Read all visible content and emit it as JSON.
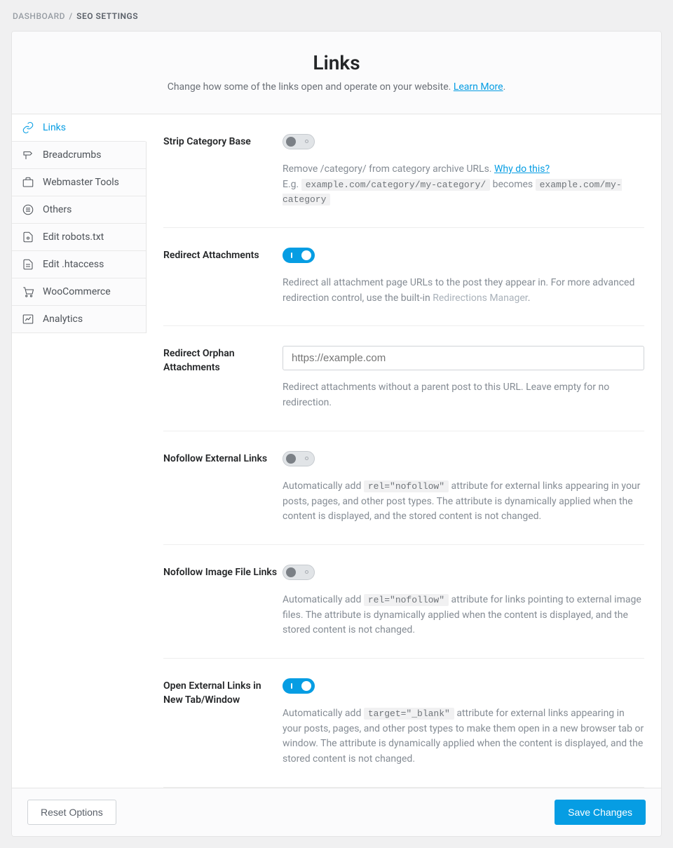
{
  "breadcrumb": {
    "parent": "Dashboard",
    "separator": "/",
    "current": "SEO Settings"
  },
  "header": {
    "title": "Links",
    "subtitle_pre": "Change how some of the links open and operate on your website. ",
    "learn_more": "Learn More",
    "subtitle_post": "."
  },
  "sidebar": {
    "items": [
      {
        "label": "Links"
      },
      {
        "label": "Breadcrumbs"
      },
      {
        "label": "Webmaster Tools"
      },
      {
        "label": "Others"
      },
      {
        "label": "Edit robots.txt"
      },
      {
        "label": "Edit .htaccess"
      },
      {
        "label": "WooCommerce"
      },
      {
        "label": "Analytics"
      }
    ]
  },
  "settings": {
    "strip_category": {
      "label": "Strip Category Base",
      "desc_pre": "Remove /category/ from category archive URLs. ",
      "why_link": "Why do this?",
      "line2_pre": "E.g. ",
      "code1": "example.com/category/my-category/",
      "middle": " becomes ",
      "code2": "example.com/my-category"
    },
    "redirect_attachments": {
      "label": "Redirect Attachments",
      "desc_pre": "Redirect all attachment page URLs to the post they appear in. For more advanced redirection control, use the built-in ",
      "link": "Redirections Manager",
      "desc_post": "."
    },
    "redirect_orphan": {
      "label": "Redirect Orphan Attachments",
      "placeholder": "https://example.com",
      "desc": "Redirect attachments without a parent post to this URL. Leave empty for no redirection."
    },
    "nofollow_external": {
      "label": "Nofollow External Links",
      "desc_pre": "Automatically add ",
      "code": "rel=\"nofollow\"",
      "desc_post": " attribute for external links appearing in your posts, pages, and other post types. The attribute is dynamically applied when the content is displayed, and the stored content is not changed."
    },
    "nofollow_image": {
      "label": "Nofollow Image File Links",
      "desc_pre": "Automatically add ",
      "code": "rel=\"nofollow\"",
      "desc_post": " attribute for links pointing to external image files. The attribute is dynamically applied when the content is displayed, and the stored content is not changed."
    },
    "open_external": {
      "label": "Open External Links in New Tab/Window",
      "desc_pre": "Automatically add ",
      "code": "target=\"_blank\"",
      "desc_post": " attribute for external links appearing in your posts, pages, and other post types to make them open in a new browser tab or window. The attribute is dynamically applied when the content is displayed, and the stored content is not changed."
    }
  },
  "footer": {
    "reset": "Reset Options",
    "save": "Save Changes"
  }
}
